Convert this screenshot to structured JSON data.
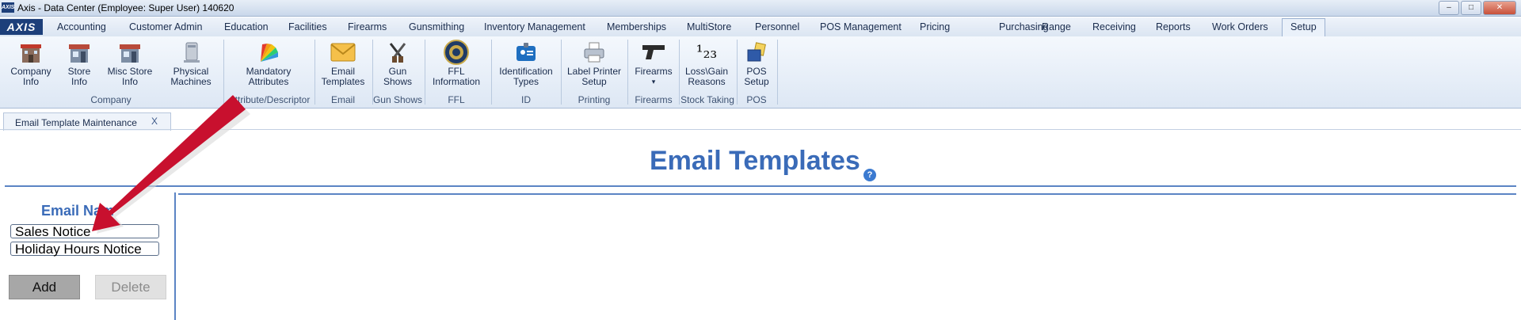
{
  "window": {
    "app_icon_text": "AXIS",
    "title": "Axis - Data Center  (Employee: Super User) 140620",
    "controls": [
      "minimize",
      "maximize",
      "close"
    ]
  },
  "menu": {
    "logo": "AXIS",
    "tabs": [
      "Accounting",
      "Customer Admin",
      "Education",
      "Facilities",
      "Firearms",
      "Gunsmithing",
      "Inventory Management",
      "Memberships",
      "MultiStore",
      "Personnel",
      "POS Management",
      "Pricing",
      "Purchasing",
      "Range",
      "Receiving",
      "Reports",
      "Work Orders",
      "Setup"
    ],
    "active_tab": "Setup"
  },
  "ribbon": {
    "buttons": [
      {
        "label_1": "Company",
        "label_2": "Info",
        "icon": "building-icon"
      },
      {
        "label_1": "Store",
        "label_2": "Info",
        "icon": "store-icon"
      },
      {
        "label_1": "Misc Store",
        "label_2": "Info",
        "icon": "store-icon"
      },
      {
        "label_1": "Physical",
        "label_2": "Machines",
        "icon": "computer-icon"
      },
      {
        "label_1": "Mandatory",
        "label_2": "Attributes",
        "icon": "color-fan-icon"
      },
      {
        "label_1": "Email",
        "label_2": "Templates",
        "icon": "envelope-icon"
      },
      {
        "label_1": "Gun",
        "label_2": "Shows",
        "icon": "crossed-guns-icon"
      },
      {
        "label_1": "FFL",
        "label_2": "Information",
        "icon": "seal-icon"
      },
      {
        "label_1": "Identification",
        "label_2": "Types",
        "icon": "id-badge-icon"
      },
      {
        "label_1": "Label Printer",
        "label_2": "Setup",
        "icon": "printer-icon"
      },
      {
        "label_1": "Firearms",
        "label_2": "▾",
        "icon": "pistol-icon"
      },
      {
        "label_1": "Loss\\Gain",
        "label_2": "Reasons",
        "icon": "numbers-icon"
      },
      {
        "label_1": "POS",
        "label_2": "Setup",
        "icon": "pos-icon"
      }
    ],
    "groups": [
      "Company",
      "Attribute/Descriptor",
      "Email",
      "Gun Shows",
      "FFL",
      "ID",
      "Printing",
      "Firearms",
      "Stock Taking",
      "POS"
    ],
    "numbers_icon_text": "¹₂₃"
  },
  "document_tab": {
    "label": "Email Template Maintenance",
    "close": "X"
  },
  "main": {
    "title": "Email Templates",
    "help": "?",
    "list_header": "Email Nam",
    "items": [
      "Sales Notice",
      "Holiday Hours Notice"
    ],
    "add_label": "Add",
    "delete_label": "Delete"
  },
  "colors": {
    "accent": "#3a6bb8",
    "arrow": "#c8102e"
  }
}
